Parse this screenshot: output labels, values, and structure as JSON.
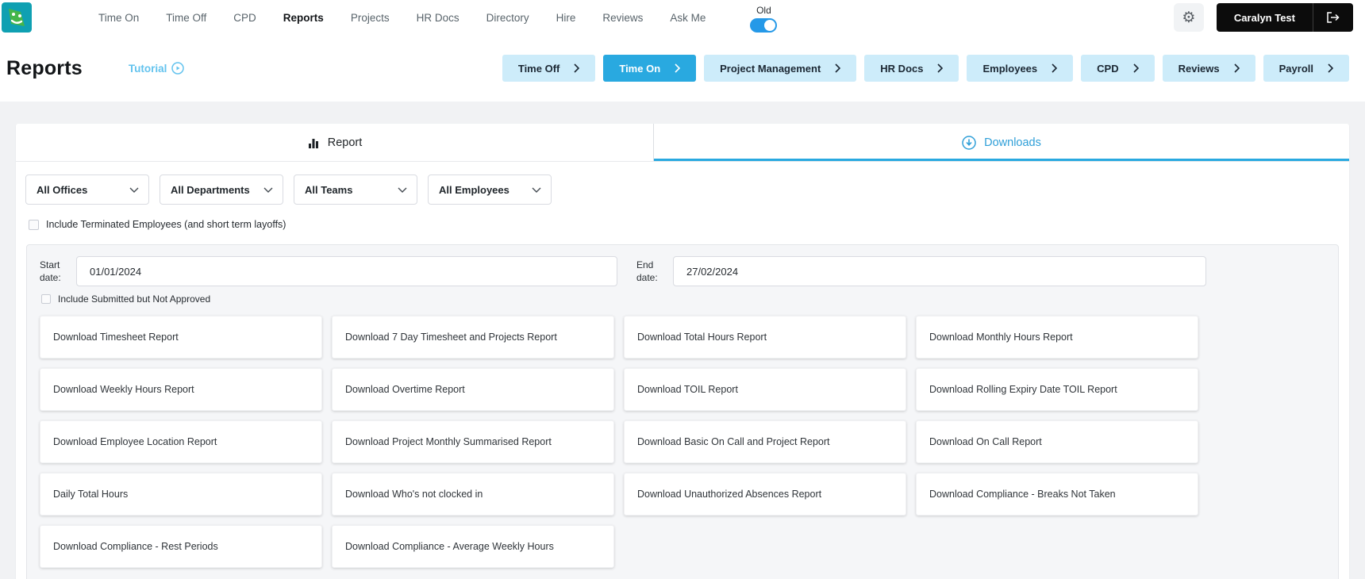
{
  "topnav": {
    "items": [
      {
        "label": "Time On",
        "active": false
      },
      {
        "label": "Time Off",
        "active": false
      },
      {
        "label": "CPD",
        "active": false
      },
      {
        "label": "Reports",
        "active": true
      },
      {
        "label": "Projects",
        "active": false
      },
      {
        "label": "HR Docs",
        "active": false
      },
      {
        "label": "Directory",
        "active": false
      },
      {
        "label": "Hire",
        "active": false
      },
      {
        "label": "Reviews",
        "active": false
      },
      {
        "label": "Ask Me",
        "active": false
      }
    ],
    "old_toggle": {
      "label": "Old",
      "on": true
    },
    "user_name": "Caralyn Test"
  },
  "header": {
    "title": "Reports",
    "tutorial_label": "Tutorial",
    "categories": [
      {
        "label": "Time Off",
        "active": false
      },
      {
        "label": "Time On",
        "active": true
      },
      {
        "label": "Project Management",
        "active": false
      },
      {
        "label": "HR Docs",
        "active": false
      },
      {
        "label": "Employees",
        "active": false
      },
      {
        "label": "CPD",
        "active": false
      },
      {
        "label": "Reviews",
        "active": false
      },
      {
        "label": "Payroll",
        "active": false
      }
    ]
  },
  "tabs": {
    "report_label": "Report",
    "downloads_label": "Downloads",
    "active_tab": "Downloads"
  },
  "filters": {
    "offices": "All Offices",
    "departments": "All Departments",
    "teams": "All Teams",
    "employees": "All Employees",
    "terminated_checkbox_label": "Include Terminated Employees (and short term layoffs)",
    "terminated_checked": false
  },
  "dates": {
    "start_label": "Start date:",
    "start_value": "01/01/2024",
    "end_label": "End date:",
    "end_value": "27/02/2024",
    "submitted_checkbox_label": "Include Submitted but Not Approved",
    "submitted_checked": false
  },
  "downloads": [
    "Download Timesheet Report",
    "Download 7 Day Timesheet and Projects Report",
    "Download Total Hours Report",
    "Download Monthly Hours Report",
    "Download Weekly Hours Report",
    "Download Overtime Report",
    "Download TOIL Report",
    "Download Rolling Expiry Date TOIL Report",
    "Download Employee Location Report",
    "Download Project Monthly Summarised Report",
    "Download Basic On Call and Project Report",
    "Download On Call Report",
    "Daily Total Hours",
    "Download Who's not clocked in",
    "Download Unauthorized Absences Report",
    "Download Compliance - Breaks Not Taken",
    "Download Compliance - Rest Periods",
    "Download Compliance - Average Weekly Hours"
  ],
  "colors": {
    "accent_blue": "#29a9e0",
    "category_light_blue": "#cdecfa",
    "link_blue": "#63c3ee",
    "downloads_tab_blue": "#2f9fd8",
    "toggle_blue": "#2599e8",
    "user_button_black": "#0c0c0c"
  }
}
